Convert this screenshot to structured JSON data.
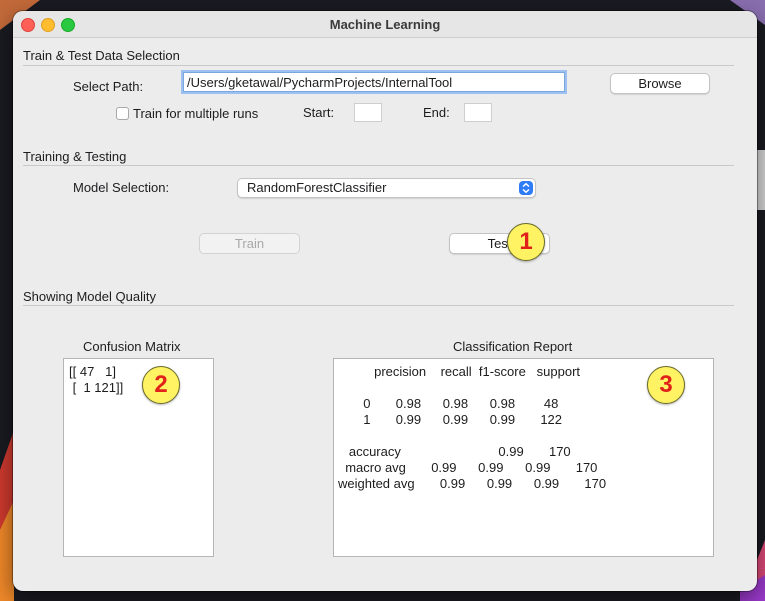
{
  "window": {
    "title": "Machine Learning"
  },
  "data_selection": {
    "section_title": "Train & Test Data Selection",
    "path_label": "Select Path:",
    "path_value": "/Users/gketawal/PycharmProjects/InternalTool",
    "browse_label": "Browse",
    "multiple_runs_label": "Train for multiple runs",
    "multiple_runs_checked": false,
    "start_label": "Start:",
    "start_value": "",
    "end_label": "End:",
    "end_value": ""
  },
  "training": {
    "section_title": "Training &  Testing",
    "model_label": "Model Selection:",
    "model_value": "RandomForestClassifier",
    "train_label": "Train",
    "test_label": "Test"
  },
  "quality": {
    "section_title": "Showing Model Quality",
    "confusion_title": "Confusion Matrix",
    "confusion_lines": [
      "[[ 47   1]",
      " [  1 121]]"
    ],
    "report_title": "Classification Report",
    "report_lines": [
      "          precision    recall  f1-score   support",
      "",
      "       0       0.98      0.98      0.98        48",
      "       1       0.99      0.99      0.99       122",
      "",
      "   accuracy                           0.99       170",
      "  macro avg       0.99      0.99      0.99       170",
      "weighted avg       0.99      0.99      0.99       170"
    ]
  },
  "annotations": [
    "1",
    "2",
    "3"
  ],
  "colors": {
    "badge_fill": "#fff263",
    "badge_text": "#e0221b",
    "focus_ring": "#9cc0f0",
    "select_accent": "#2f7cf6"
  }
}
